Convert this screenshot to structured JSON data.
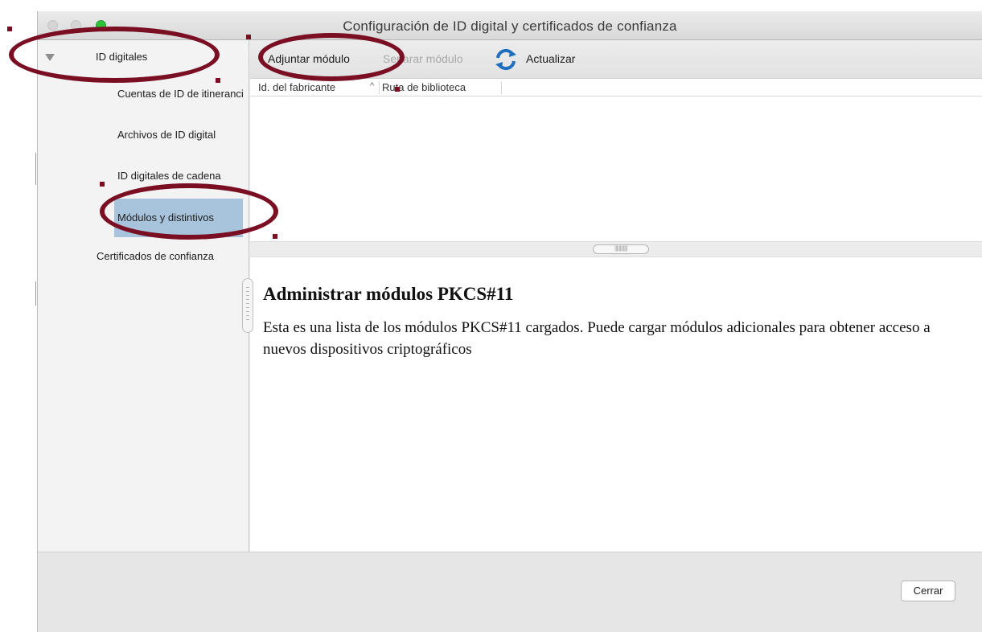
{
  "window": {
    "title": "Configuración de ID digital y certificados de confianza"
  },
  "sidebar": {
    "items": [
      {
        "label": "ID digitales"
      },
      {
        "label": "Cuentas de ID de itinerancia"
      },
      {
        "label": "Archivos de ID digital"
      },
      {
        "label": "ID digitales de cadena"
      },
      {
        "label": "Módulos y distintivos"
      },
      {
        "label": "Certificados de confianza"
      }
    ],
    "selected": "Módulos y distintivos"
  },
  "toolbar": {
    "attach_label": "Adjuntar módulo",
    "detach_label": "Separar módulo",
    "refresh_label": "Actualizar"
  },
  "table": {
    "columns": [
      "Id. del fabricante",
      "Ruta de biblioteca"
    ],
    "rows": []
  },
  "description": {
    "heading": "Administrar módulos PKCS#11",
    "body": "Esta es una lista de los módulos PKCS#11 cargados. Puede cargar módulos adicionales para obtener acceso a nuevos dispositivos criptográficos"
  },
  "footer": {
    "close_label": "Cerrar"
  },
  "colors": {
    "annotation": "#7a0f24",
    "selection": "#a7c4dc",
    "maximize": "#2dc33b",
    "refresh_icon": "#1f6fbf"
  },
  "icons": {
    "disclosure": "disclosure-triangle-icon",
    "refresh": "refresh-icon"
  }
}
